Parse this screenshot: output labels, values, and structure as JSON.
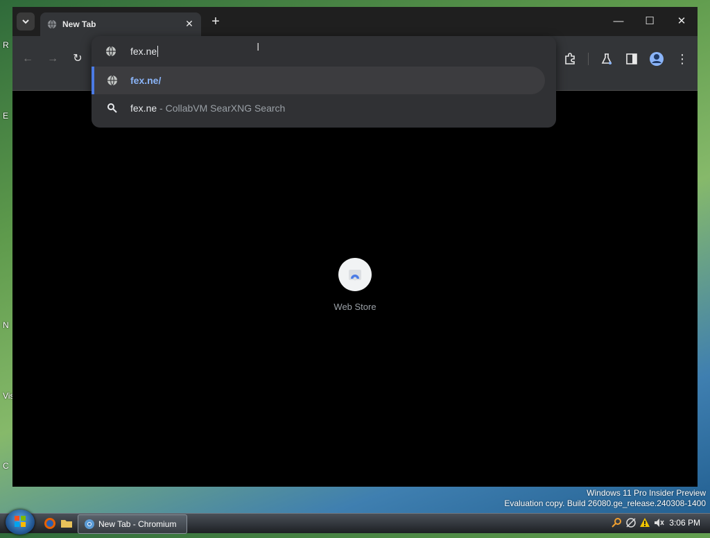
{
  "desktop": {
    "edge_labels": [
      "R",
      "E",
      "N",
      "Vis",
      "C"
    ],
    "watermark": {
      "line1": "Windows 11 Pro Insider Preview",
      "line2": "Evaluation copy. Build 26080.ge_release.240308-1400"
    }
  },
  "browser": {
    "tab": {
      "title": "New Tab",
      "favicon": "globe-icon"
    },
    "window_controls": [
      "minimize-icon",
      "maximize-icon",
      "close-icon"
    ],
    "toolbar": {
      "nav_icons": [
        "back-icon",
        "forward-icon",
        "reload-icon"
      ],
      "right_icons": [
        "extensions-icon",
        "labs-icon",
        "side-panel-icon",
        "profile-icon",
        "menu-icon"
      ]
    },
    "omnibox": {
      "input_value": "fex.ne",
      "suggestions": [
        {
          "icon": "globe-icon",
          "text": "fex.ne/",
          "selected": true
        },
        {
          "icon": "search-icon",
          "text": "fex.ne",
          "separator": " - ",
          "description": "CollabVM SearXNG Search",
          "selected": false
        }
      ]
    },
    "shortcuts": [
      {
        "label": "Web Store",
        "icon": "web-store-icon"
      }
    ],
    "colors": {
      "accent": "#4b7be5",
      "link": "#8ab4f8",
      "background": "#000000",
      "toolbar": "#333538"
    }
  },
  "taskbar": {
    "task_button_label": "New Tab - Chromium",
    "clock": "3:06 PM",
    "quick_launch": [
      "firefox-icon",
      "folder-icon"
    ],
    "tray_icons": [
      "search-icon",
      "network-icon",
      "warning-icon",
      "volume-icon"
    ]
  }
}
